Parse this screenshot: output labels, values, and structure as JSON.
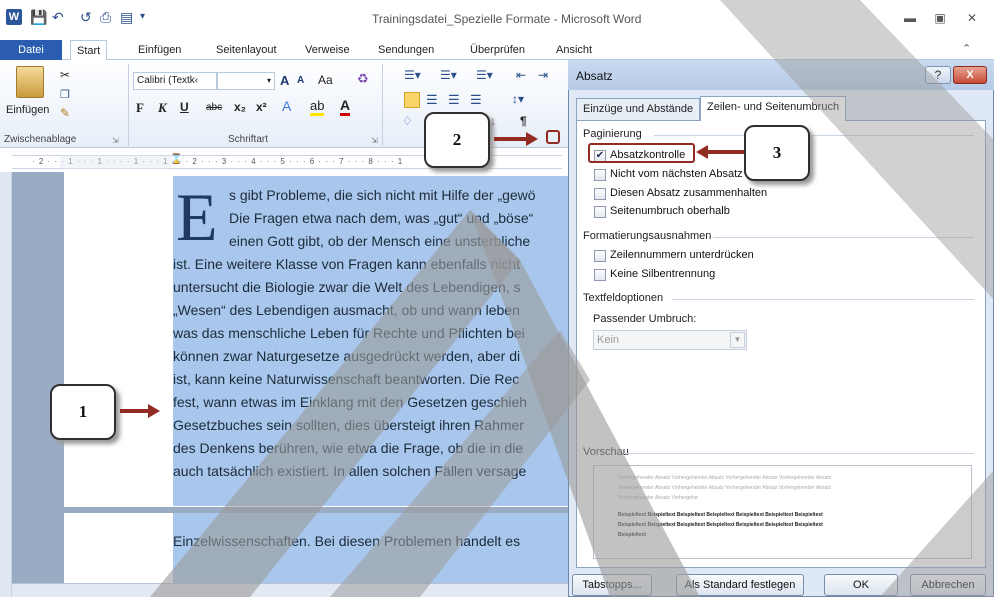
{
  "window": {
    "title": "Trainingsdatei_Spezielle Formate - Microsoft Word",
    "app_icon_letter": "W"
  },
  "ribbon_tabs": [
    "Datei",
    "Start",
    "Einfügen",
    "Seitenlayout",
    "Verweise",
    "Sendungen",
    "Überprüfen",
    "Ansicht"
  ],
  "ribbon": {
    "paste_label": "Einfügen",
    "font_name": "Calibri (Textk‹",
    "group_clipboard": "Zwischenablage",
    "group_font": "Schriftart",
    "bold": "F",
    "italic": "K",
    "underline": "U",
    "strike": "abc",
    "subscript": "x₂",
    "superscript": "x²",
    "change_case": "Aa",
    "grow_font": "A",
    "shrink_font": "A"
  },
  "ruler": {
    "text": "· 2 · · · 1 · · · 1 · · · · 1 · · · 1 · · · 2 · · · 3 · · · 4 · · · 5 · · · 6 · · · 7 · · · 8 · · · 1",
    "tab_selector": "L"
  },
  "document": {
    "drop_cap": "E",
    "lines": [
      "s gibt Probleme, die sich nicht mit Hilfe der „gewö",
      "Die Fragen etwa nach dem, was „gut“ und „böse“",
      "einen Gott gibt, ob der Mensch eine unsterbliche",
      "ist. Eine weitere Klasse von Fragen kann ebenfalls nicht",
      "untersucht die Biologie zwar die Welt des Lebendigen, s",
      "„Wesen“ des Lebendigen ausmacht, ob und wann leben",
      "was das menschliche Leben für Rechte und Pflichten bei",
      "können zwar Naturgesetze ausgedrückt werden, aber di",
      "ist, kann keine Naturwissenschaft beantworten. Die Rec",
      "fest, wann etwas im Einklang mit den Gesetzen geschieh",
      "Gesetzbuches sein sollten, dies übersteigt ihren Rahmer",
      "des Denkens berühren, wie etwa die Frage, ob die in die",
      "auch tatsächlich existiert. In allen solchen Fällen versage"
    ],
    "next_page_line": "Einzelwissenschaften. Bei diesen Problemen handelt es"
  },
  "dialog": {
    "title": "Absatz",
    "help": "?",
    "close": "X",
    "tabs": [
      "Einzüge und Abstände",
      "Zeilen- und Seitenumbruch"
    ],
    "section_pagination": "Paginierung",
    "pagination_options": [
      {
        "label": "Absatzkontrolle",
        "checked": true
      },
      {
        "label": "Nicht vom nächsten Absatz trennen",
        "checked": false
      },
      {
        "label": "Diesen Absatz zusammenhalten",
        "checked": false
      },
      {
        "label": "Seitenumbruch oberhalb",
        "checked": false
      }
    ],
    "section_exceptions": "Formatierungsausnahmen",
    "exception_options": [
      {
        "label": "Zeilennummern unterdrücken",
        "checked": false
      },
      {
        "label": "Keine Silbentrennung",
        "checked": false
      }
    ],
    "section_textbox": "Textfeldoptionen",
    "tight_wrap_label": "Passender Umbruch:",
    "tight_wrap_value": "Kein",
    "section_preview": "Vorschau",
    "preview_prev": "Vorhergehender Absatz Vorhergehender Absatz Vorhergehender Absatz Vorhergehender Absatz",
    "preview_sample": "Beispieltext Beispieltext Beispieltext Beispieltext Beispieltext Beispieltext Beispieltext",
    "preview_sample_end": "Beispieltext",
    "buttons": {
      "tabs": "Tabstopps...",
      "default": "Als Standard festlegen",
      "ok": "OK",
      "cancel": "Abbrechen"
    }
  },
  "callouts": [
    "1",
    "2",
    "3"
  ],
  "colors": {
    "accent": "#2a5db0",
    "highlight": "#a9c7ec",
    "callout_arrow": "#922b21",
    "dropcap": "#1f3864"
  }
}
